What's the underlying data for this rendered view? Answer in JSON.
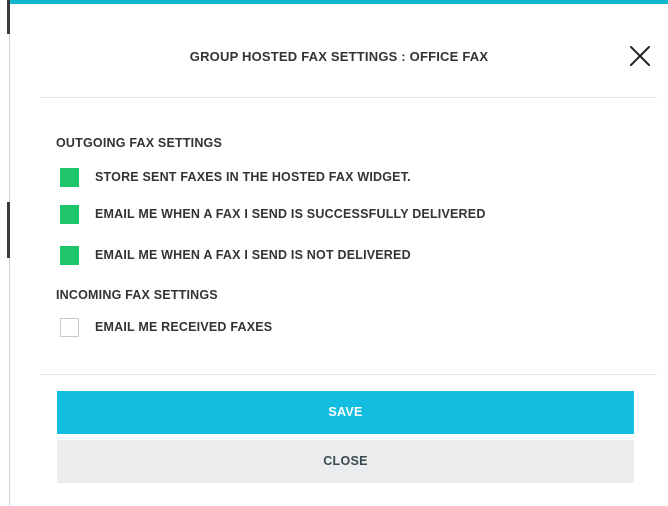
{
  "colors": {
    "accent": "#12bde0",
    "checked": "#20c76a",
    "close_bg": "#ebeced",
    "text": "#333333"
  },
  "modal": {
    "title": "GROUP HOSTED FAX SETTINGS : OFFICE FAX",
    "close_icon": "close-x-icon"
  },
  "outgoing": {
    "heading": "OUTGOING FAX SETTINGS",
    "options": [
      {
        "label": "STORE SENT FAXES IN THE HOSTED FAX WIDGET.",
        "checked": true
      },
      {
        "label": "EMAIL ME WHEN A FAX I SEND IS SUCCESSFULLY DELIVERED",
        "checked": true
      },
      {
        "label": "EMAIL ME WHEN A FAX I SEND IS NOT DELIVERED",
        "checked": true
      }
    ]
  },
  "incoming": {
    "heading": "INCOMING FAX SETTINGS",
    "options": [
      {
        "label": "EMAIL ME RECEIVED FAXES",
        "checked": false
      }
    ]
  },
  "buttons": {
    "save_label": "SAVE",
    "close_label": "CLOSE"
  }
}
